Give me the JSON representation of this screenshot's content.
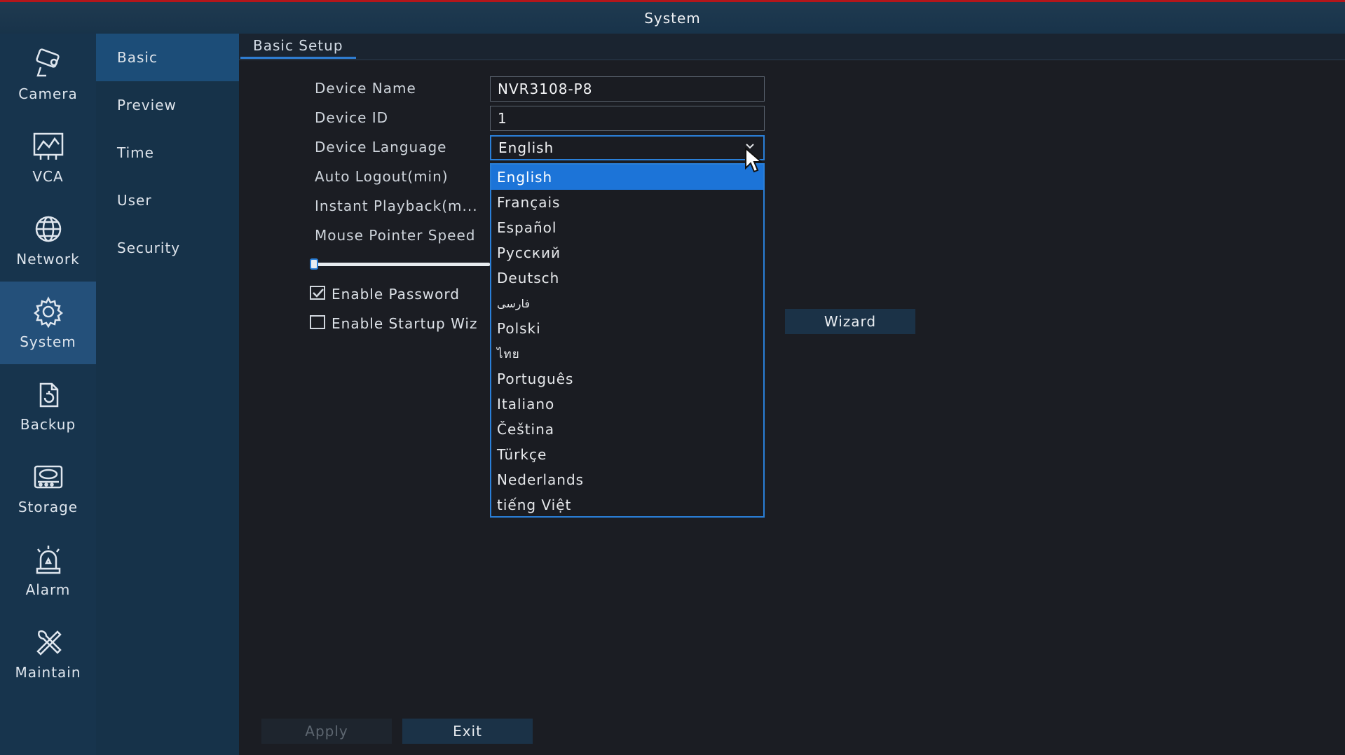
{
  "window": {
    "title": "System"
  },
  "left_nav": [
    {
      "label": "Camera",
      "icon": "camera-icon"
    },
    {
      "label": "VCA",
      "icon": "vca-chart-icon"
    },
    {
      "label": "Network",
      "icon": "globe-icon"
    },
    {
      "label": "System",
      "icon": "gear-icon",
      "active": true
    },
    {
      "label": "Backup",
      "icon": "backup-icon"
    },
    {
      "label": "Storage",
      "icon": "hard-drive-icon"
    },
    {
      "label": "Alarm",
      "icon": "alarm-siren-icon"
    },
    {
      "label": "Maintain",
      "icon": "wrench-screwdriver-icon"
    }
  ],
  "sub_nav": [
    {
      "label": "Basic",
      "active": true
    },
    {
      "label": "Preview"
    },
    {
      "label": "Time"
    },
    {
      "label": "User"
    },
    {
      "label": "Security"
    }
  ],
  "tab": {
    "label": "Basic Setup"
  },
  "form": {
    "device_name": {
      "label": "Device Name",
      "value": "NVR3108-P8"
    },
    "device_id": {
      "label": "Device ID",
      "value": "1"
    },
    "device_language": {
      "label": "Device Language",
      "value": "English"
    },
    "auto_logout": {
      "label": "Auto Logout(min)"
    },
    "instant_playback": {
      "label": "Instant Playback(m..."
    },
    "mouse_pointer_speed": {
      "label": "Mouse Pointer Speed",
      "level": 0
    },
    "enable_password": {
      "label": "Enable Password",
      "checked": true
    },
    "enable_startup_wizard": {
      "label": "Enable Startup Wiz",
      "checked": false
    }
  },
  "language_options": [
    "English",
    "Français",
    "Español",
    "Русский",
    "Deutsch",
    "فارسی",
    "Polski",
    "ไทย",
    "Português",
    "Italiano",
    "Čeština",
    "Türkçe",
    "Nederlands",
    "tiếng Việt"
  ],
  "selected_language_index": 0,
  "buttons": {
    "wizard": "Wizard",
    "apply": "Apply",
    "exit": "Exit"
  },
  "colors": {
    "accent": "#2a7fd8",
    "selected": "#1c74d8",
    "nav_bg": "#17344d",
    "title_border": "#b4161b"
  }
}
